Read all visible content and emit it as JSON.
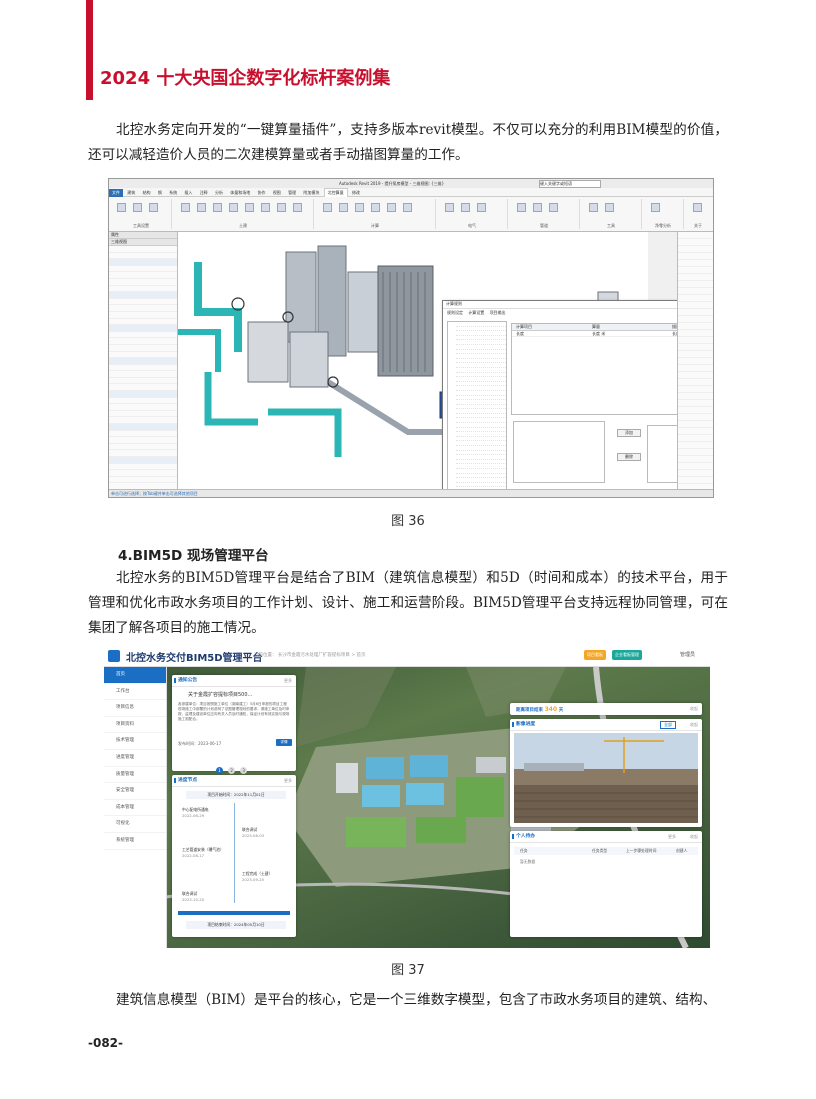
{
  "header": {
    "title": "2024 十大央国企数字化标杆案例集"
  },
  "paragraphs": {
    "p1": "北控水务定向开发的“一键算量插件”，支持多版本revit模型。不仅可以充分的利用BIM模型的价值，还可以减轻造价人员的二次建模算量或者手动描图算量的工作。",
    "section_title": "4.BIM5D 现场管理平台",
    "p2": "北控水务的BIM5D管理平台是结合了BIM（建筑信息模型）和5D（时间和成本）的技术平台，用于管理和优化市政水务项目的工作计划、设计、施工和运营阶段。BIM5D管理平台支持远程协同管理，可在集团了解各项目的施工情况。",
    "p3": "建筑信息模型（BIM）是平台的核心，它是一个三维数字模型，包含了市政水务项目的建筑、结构、"
  },
  "figures": {
    "fig36_caption": "图 36",
    "fig37_caption": "图 37"
  },
  "page": {
    "number": "-082-"
  },
  "colors": {
    "accent": "#c8102e",
    "brand_blue": "#1a6fc4"
  },
  "bim5d": {
    "title": "北控水务交付BIM5D管理平台",
    "breadcrumb": "当前位置： 长沙市金霞污水处理厂扩容提标项目 > 首页",
    "btn_a": "项目看板",
    "btn_b": "企业看板管理",
    "user": "管理员",
    "menu": [
      "首页",
      "工作台",
      "项目信息",
      "项目资料",
      "技术管理",
      "进度管理",
      "质量管理",
      "安全管理",
      "成本管理",
      "可视化",
      "系统管理"
    ],
    "notice": {
      "title": "通知公告",
      "more": "更多",
      "headline": "关于金霞扩容提标项目500...",
      "body": "各参建单位：项目按照施工单位（湖南建工）5月6日申报的项目工程现场施工中部署的计划说明了总图管理规划的要求，请施工单位及时申报，监理及建设单位应向有关人员及时通知，保证计划有效实施与现场施工相配合。",
      "date": "发布时间：2023-06-17",
      "detail": "详情",
      "pages": [
        "1",
        "2",
        "3"
      ]
    },
    "milestones": {
      "title": "进度节点",
      "more": "更多",
      "start": "项目开始时间：2022年11月01日",
      "end": "项目结束时间：2024年05月10日",
      "items": [
        {
          "name": "中心配电所通电",
          "date": "2022-06-29"
        },
        {
          "name": "联合调试",
          "date": "2023-06-03"
        },
        {
          "name": "工艺管道安装（曝气池）",
          "date": "2022-08-17"
        },
        {
          "name": "工程完成（土建）",
          "date": "2023-09-25"
        },
        {
          "name": "联合调试",
          "date": "2023-10-20"
        }
      ]
    },
    "countdown": {
      "label": "距离项目结束",
      "days": "340",
      "unit": "天",
      "collapse": "收起"
    },
    "image_progress": {
      "title": "影像进度",
      "select": "全部",
      "collapse": "收起"
    },
    "todo": {
      "title": "个人待办",
      "more": "更多",
      "collapse": "收起",
      "columns": [
        "任务",
        "任务类型",
        "上一步骤处理时间",
        "创建人"
      ],
      "empty": "暂无数据"
    }
  },
  "revit": {
    "window_title": "Autodesk Revit 2019 - 提升泵房模型 - 三维视图: {三维}",
    "search": "键入关键字或短语",
    "tabs": [
      "文件",
      "建筑",
      "结构",
      "钢",
      "系统",
      "插入",
      "注释",
      "分析",
      "体量和场地",
      "协作",
      "视图",
      "管理",
      "附加模块",
      "北控算量",
      "修改"
    ],
    "ribbon_groups": [
      "工具设置",
      "土建",
      "计算",
      "导出",
      "结构",
      "电气",
      "管道",
      "工具",
      "净零分析",
      "关于"
    ],
    "left_panel_title": "属性",
    "view_name": "三维视图",
    "dialog_title": "计算规则",
    "dialog_tabs": [
      "规则设定",
      "计算设置",
      "项目输出"
    ],
    "dialog_cols": [
      "计算项目",
      "算量",
      "描述"
    ],
    "dialog_row": [
      "长度",
      "长度 米",
      "长度"
    ],
    "dialog_buttons": [
      "添加",
      "删除",
      "导入",
      "导出",
      "默认",
      "取消",
      "确定"
    ],
    "status": "单击可进行选择；按Tab键并单击可选择其他项目"
  }
}
